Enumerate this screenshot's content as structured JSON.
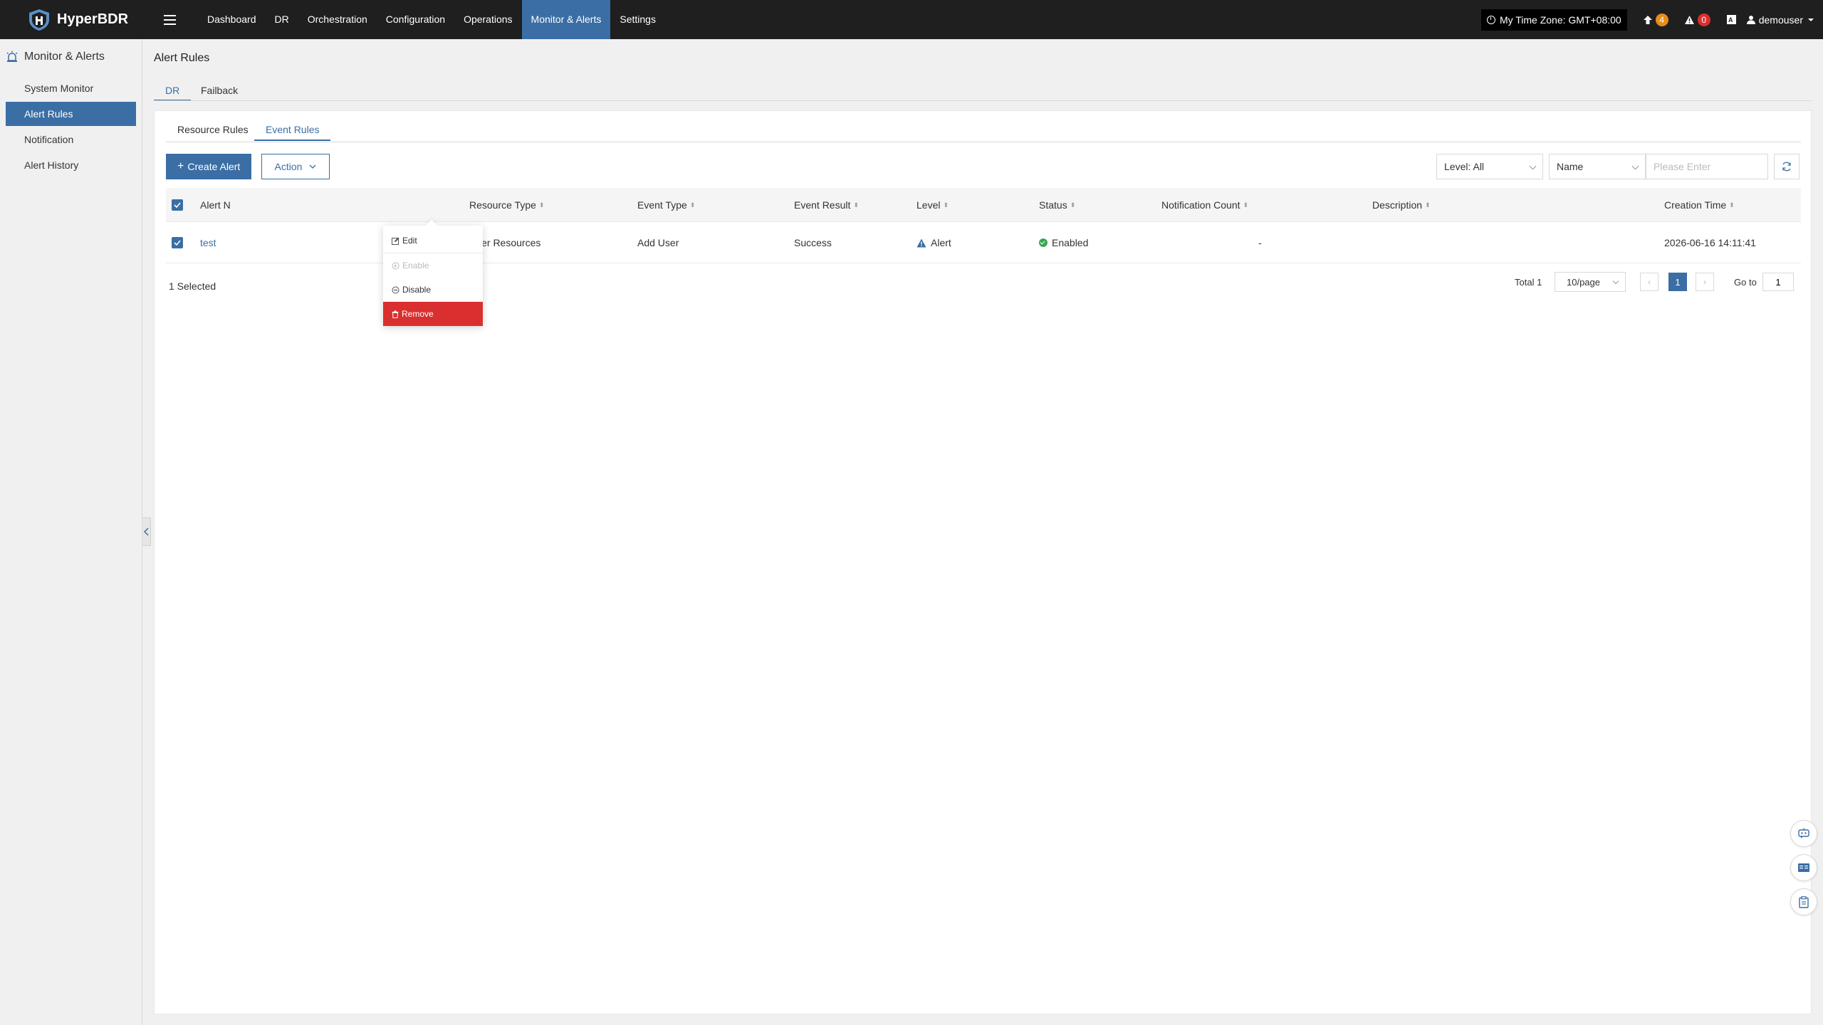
{
  "app": {
    "name": "HyperBDR"
  },
  "nav": {
    "items": [
      "Dashboard",
      "DR",
      "Orchestration",
      "Configuration",
      "Operations",
      "Monitor & Alerts",
      "Settings"
    ],
    "active": "Monitor & Alerts"
  },
  "topright": {
    "timezone": "My Time Zone: GMT+08:00",
    "upgrade_count": "4",
    "alert_count": "0",
    "user": "demouser"
  },
  "sidebar": {
    "title": "Monitor & Alerts",
    "items": [
      {
        "label": "System Monitor",
        "active": false
      },
      {
        "label": "Alert Rules",
        "active": true
      },
      {
        "label": "Notification",
        "active": false
      },
      {
        "label": "Alert History",
        "active": false
      }
    ]
  },
  "page": {
    "title": "Alert Rules",
    "tabs": [
      "DR",
      "Failback"
    ],
    "subtabs": [
      "Resource Rules",
      "Event Rules"
    ]
  },
  "toolbar": {
    "create_label": "Create Alert",
    "action_label": "Action",
    "level_filter": "Level: All",
    "field_select": "Name",
    "search_placeholder": "Please Enter"
  },
  "table": {
    "columns": [
      "Alert N",
      "Resource Type",
      "Event Type",
      "Event Result",
      "Level",
      "Status",
      "Notification Count",
      "Description",
      "Creation Time"
    ],
    "rows": [
      {
        "name": "test",
        "resource_type": "User Resources",
        "event_type": "Add User",
        "event_result": "Success",
        "level": "Alert",
        "status": "Enabled",
        "notification_count": "-",
        "description": "",
        "creation_time": "2026-06-16 14:11:41"
      }
    ]
  },
  "footer": {
    "selected": "1 Selected",
    "total": "Total 1",
    "page_size": "10/page",
    "current_page": "1",
    "goto_label": "Go to",
    "goto_value": "1"
  },
  "action_menu": {
    "items": [
      {
        "label": "Edit",
        "icon": "edit-icon",
        "state": "normal"
      },
      {
        "label": "Enable",
        "icon": "enable-icon",
        "state": "disabled"
      },
      {
        "label": "Disable",
        "icon": "disable-icon",
        "state": "normal"
      },
      {
        "label": "Remove",
        "icon": "trash-icon",
        "state": "danger"
      }
    ]
  },
  "colors": {
    "topbar": "#1f1f1f",
    "accent": "#3a6ea5",
    "danger": "#d9302f",
    "success": "#3aa655",
    "warning_badge": "#e88c1b"
  },
  "floating_buttons": [
    "chatbot-icon",
    "manual-icon",
    "clipboard-icon"
  ]
}
